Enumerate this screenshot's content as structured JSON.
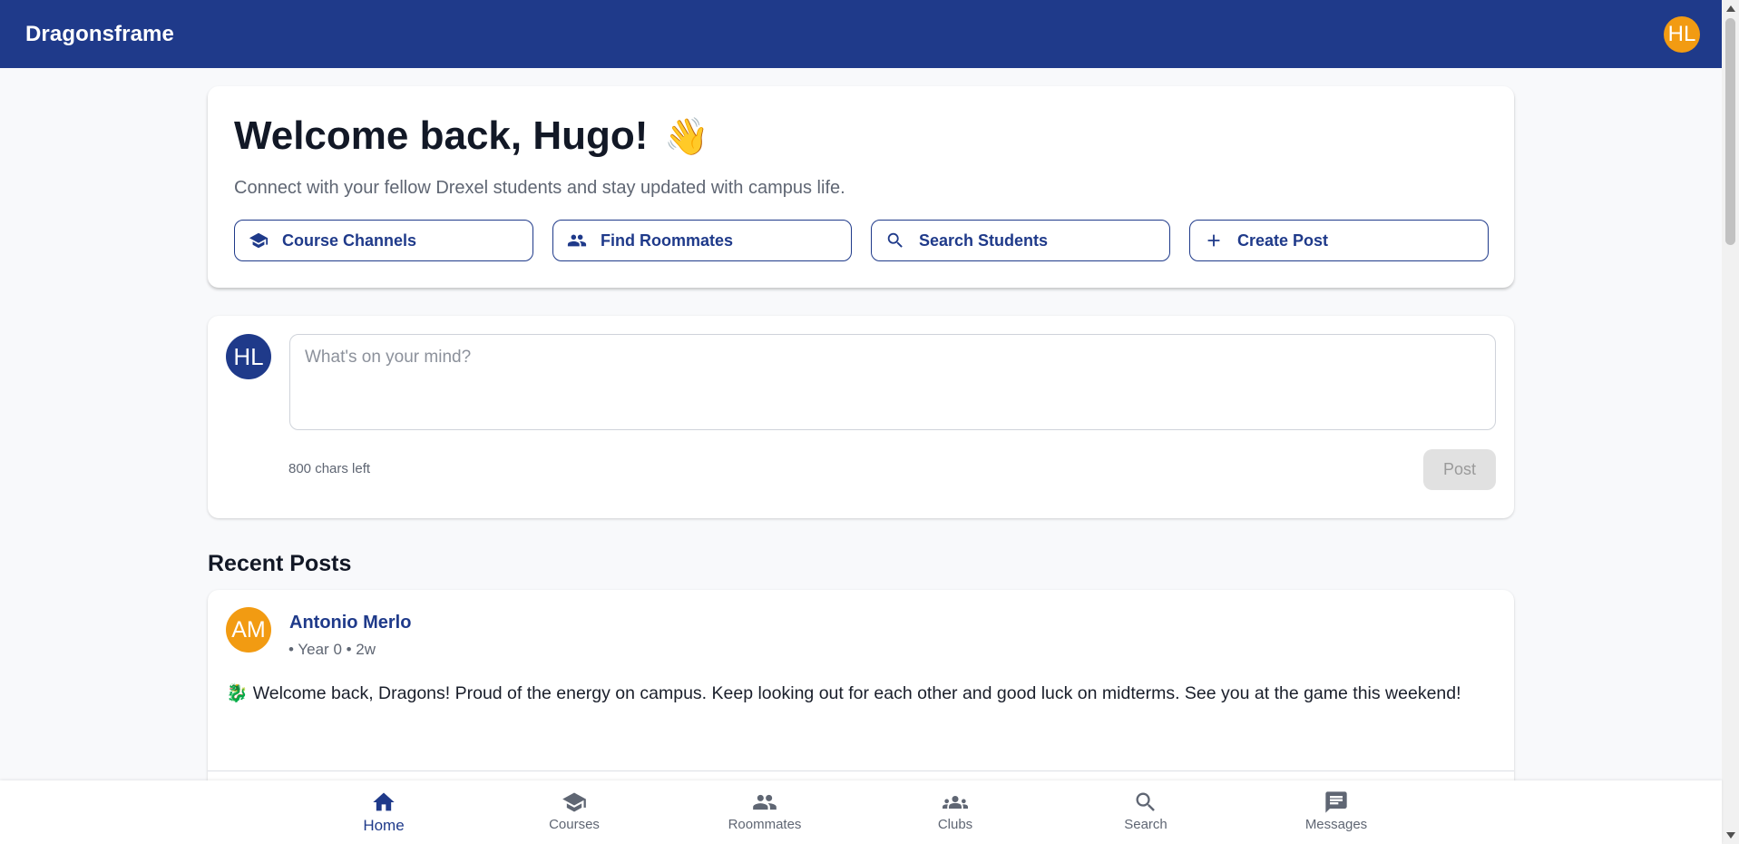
{
  "app": {
    "brand": "Dragonsframe",
    "user_initials": "HL"
  },
  "welcome": {
    "title": "Welcome back, Hugo!",
    "emoji": "👋",
    "subtitle": "Connect with your fellow Drexel students and stay updated with campus life.",
    "actions": [
      {
        "label": "Course Channels",
        "icon": "graduation-cap-icon"
      },
      {
        "label": "Find Roommates",
        "icon": "people-icon"
      },
      {
        "label": "Search Students",
        "icon": "search-icon"
      },
      {
        "label": "Create Post",
        "icon": "plus-icon"
      }
    ]
  },
  "composer": {
    "avatar_initials": "HL",
    "placeholder": "What's on your mind?",
    "chars_left": "800 chars left",
    "post_label": "Post"
  },
  "recent": {
    "title": "Recent Posts",
    "posts": [
      {
        "avatar_initials": "AM",
        "author": "Antonio Merlo",
        "meta": "• Year 0 • 2w",
        "body": "🐉 Welcome back, Dragons! Proud of the energy on campus. Keep looking out for each other and good luck on midterms. See you at the game this weekend!"
      }
    ]
  },
  "nav": {
    "items": [
      {
        "label": "Home",
        "icon": "home-icon",
        "active": true
      },
      {
        "label": "Courses",
        "icon": "graduation-cap-icon",
        "active": false
      },
      {
        "label": "Roommates",
        "icon": "people-icon",
        "active": false
      },
      {
        "label": "Clubs",
        "icon": "groups-icon",
        "active": false
      },
      {
        "label": "Search",
        "icon": "search-icon",
        "active": false
      },
      {
        "label": "Messages",
        "icon": "message-icon",
        "active": false
      }
    ]
  },
  "colors": {
    "primary": "#1f3a8a",
    "accent_avatar": "#f29b12",
    "background": "#f8f9fb"
  }
}
